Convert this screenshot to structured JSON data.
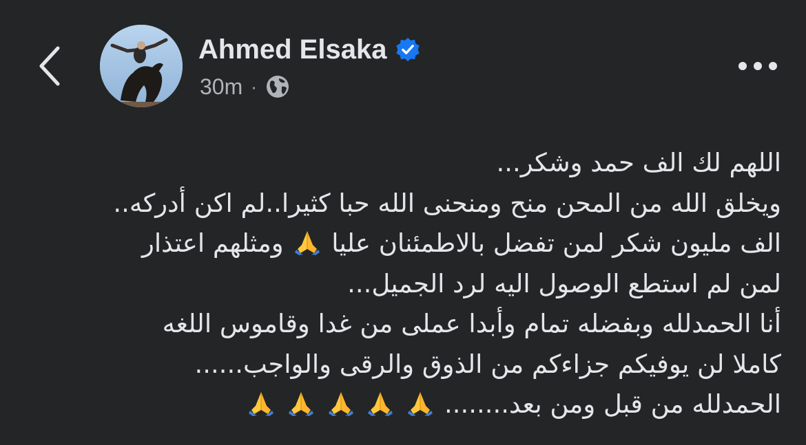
{
  "header": {
    "author_name": "Ahmed Elsaka",
    "verified_icon": "verified-badge-icon",
    "timestamp": "30m",
    "separator": "·",
    "audience_icon": "globe-icon",
    "back_icon": "chevron-left-icon",
    "more_icon": "more-dots-icon"
  },
  "post": {
    "lines": [
      "اللهم لك الف حمد وشكر...",
      "ويخلق الله من المحن منح ومنحنى الله حبا كثيرا..لم اكن أدركه..",
      "الف مليون شكر لمن تفضل بالاطمئنان عليا",
      "ومثلهم اعتذار",
      "لمن لم استطع الوصول اليه لرد الجميل...",
      "أنا الحمدلله وبفضله تمام وأبدا عملى من غدا وقاموس اللغه",
      "كاملا لن يوفيكم جزاءكم من الذوق والرقى والواجب......",
      "الحمدلله من قبل ومن بعد........"
    ],
    "emoji_name": "folded-hands-emoji"
  },
  "colors": {
    "background": "#242526",
    "primary_text": "#e4e6eb",
    "secondary_text": "#b0b3b8",
    "verified_blue": "#1877f2"
  }
}
